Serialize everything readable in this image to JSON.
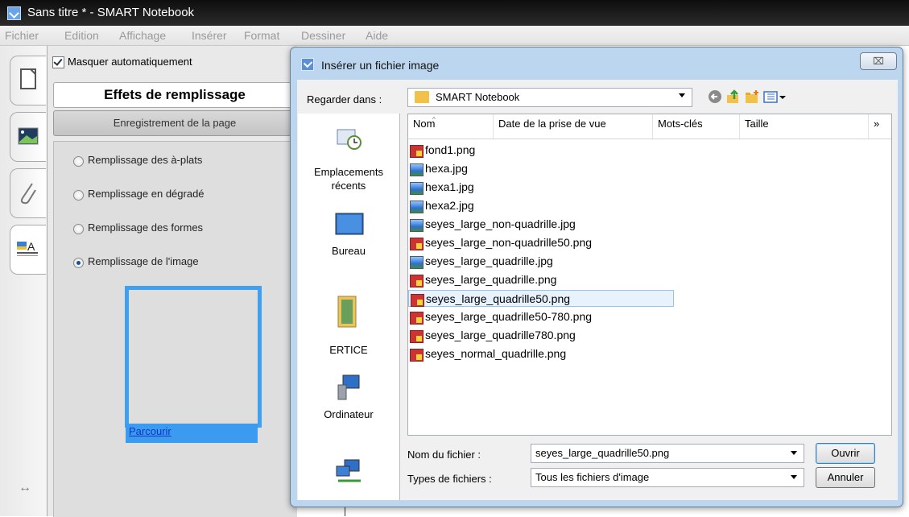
{
  "app": {
    "window_title": "Sans titre * - SMART Notebook"
  },
  "menu": [
    "Fichier",
    "Edition",
    "Affichage",
    "Insérer",
    "Format",
    "Dessiner",
    "Aide"
  ],
  "panel": {
    "auto_hide_label": "Masquer automatiquement",
    "auto_hide_checked": true,
    "fill_effects_button": "Effets de remplissage",
    "page_recording_button": "Enregistrement de la page",
    "fill_options": [
      {
        "label": "Remplissage des à-plats",
        "selected": false
      },
      {
        "label": "Remplissage en dégradé",
        "selected": false
      },
      {
        "label": "Remplissage des formes",
        "selected": false
      },
      {
        "label": "Remplissage de l'image",
        "selected": true
      }
    ],
    "browse_link": "Parcourir"
  },
  "dialog": {
    "title": "Insérer un fichier image",
    "close_glyph": "⌧",
    "look_in_label": "Regarder dans :",
    "look_in_value": "SMART Notebook",
    "places": [
      "Emplacements récents",
      "Bureau",
      "ERTICE",
      "Ordinateur"
    ],
    "columns": [
      "Nom",
      "Date de la prise de vue",
      "Mots-clés",
      "Taille",
      "»"
    ],
    "files": [
      {
        "name": "fond1.png",
        "type": "png"
      },
      {
        "name": "hexa.jpg",
        "type": "jpg"
      },
      {
        "name": "hexa1.jpg",
        "type": "jpg"
      },
      {
        "name": "hexa2.jpg",
        "type": "jpg"
      },
      {
        "name": "seyes_large_non-quadrille.jpg",
        "type": "jpg"
      },
      {
        "name": "seyes_large_non-quadrille50.png",
        "type": "png"
      },
      {
        "name": "seyes_large_quadrille.jpg",
        "type": "jpg"
      },
      {
        "name": "seyes_large_quadrille.png",
        "type": "png"
      },
      {
        "name": "seyes_large_quadrille50.png",
        "type": "png"
      },
      {
        "name": "seyes_large_quadrille50-780.png",
        "type": "png"
      },
      {
        "name": "seyes_large_quadrille780.png",
        "type": "png"
      },
      {
        "name": "seyes_normal_quadrille.png",
        "type": "png"
      }
    ],
    "selected_file": "seyes_large_quadrille50.png",
    "filename_label": "Nom du fichier :",
    "filename_value": "seyes_large_quadrille50.png",
    "filetype_label": "Types de fichiers :",
    "filetype_value": "Tous les fichiers d'image",
    "open_button": "Ouvrir",
    "cancel_button": "Annuler"
  },
  "colors": {
    "selection_highlight": "#3b9bf0",
    "link": "#0d36c2",
    "dialog_frame": "#bcd6ef"
  }
}
